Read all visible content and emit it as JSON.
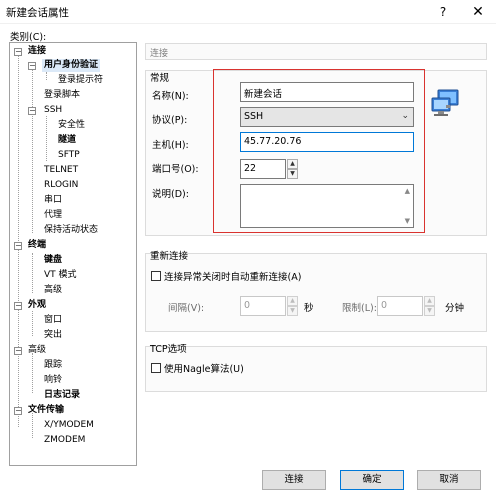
{
  "window": {
    "title": "新建会话属性",
    "help": "?",
    "close": "✕"
  },
  "category_label": "类别(C):",
  "tree": [
    {
      "label": "连接",
      "bold": true
    },
    {
      "label": "用户身份验证",
      "bold": true
    },
    {
      "label": "登录提示符"
    },
    {
      "label": "登录脚本"
    },
    {
      "label": "SSH"
    },
    {
      "label": "安全性"
    },
    {
      "label": "隧道",
      "bold": true
    },
    {
      "label": "SFTP"
    },
    {
      "label": "TELNET"
    },
    {
      "label": "RLOGIN"
    },
    {
      "label": "串口"
    },
    {
      "label": "代理"
    },
    {
      "label": "保持活动状态"
    },
    {
      "label": "终端",
      "bold": true
    },
    {
      "label": "键盘",
      "bold": true
    },
    {
      "label": "VT 模式"
    },
    {
      "label": "高级"
    },
    {
      "label": "外观",
      "bold": true
    },
    {
      "label": "窗口"
    },
    {
      "label": "突出"
    },
    {
      "label": "高级"
    },
    {
      "label": "跟踪"
    },
    {
      "label": "响铃"
    },
    {
      "label": "日志记录",
      "bold": true
    },
    {
      "label": "文件传输",
      "bold": true
    },
    {
      "label": "X/YMODEM"
    },
    {
      "label": "ZMODEM"
    }
  ],
  "header": "连接",
  "general": {
    "title": "常规",
    "name_label": "名称(N):",
    "name_value": "新建会话",
    "protocol_label": "协议(P):",
    "protocol_value": "SSH",
    "host_label": "主机(H):",
    "host_value": "45.77.20.76",
    "port_label": "端口号(O):",
    "port_value": "22",
    "desc_label": "说明(D):",
    "desc_value": ""
  },
  "reconnect": {
    "title": "重新连接",
    "auto_label": "连接异常关闭时自动重新连接(A)",
    "interval_label": "间隔(V):",
    "interval_value": "0",
    "seconds": "秒",
    "limit_label": "限制(L):",
    "limit_value": "0",
    "minutes": "分钟"
  },
  "tcp": {
    "title": "TCP选项",
    "nagle_label": "使用Nagle算法(U)"
  },
  "buttons": {
    "connect": "连接",
    "ok": "确定",
    "cancel": "取消"
  },
  "colors": {
    "highlight_border": "#d9332f",
    "focus_border": "#0078d7"
  }
}
